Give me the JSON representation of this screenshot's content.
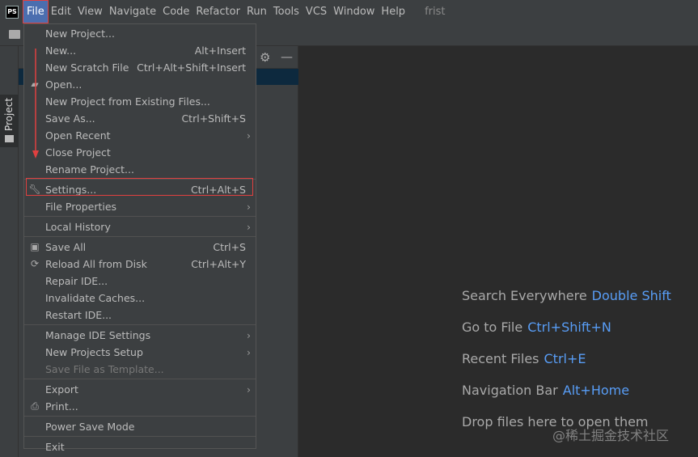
{
  "menubar": {
    "logo": "PS",
    "items": [
      "File",
      "Edit",
      "View",
      "Navigate",
      "Code",
      "Refactor",
      "Run",
      "Tools",
      "VCS",
      "Window",
      "Help"
    ],
    "project_name": "frist"
  },
  "sidebar": {
    "tab_label": "Project"
  },
  "file_menu": [
    {
      "label": "New Project...",
      "shortcut": ""
    },
    {
      "label": "New...",
      "shortcut": "Alt+Insert"
    },
    {
      "label": "New Scratch File",
      "shortcut": "Ctrl+Alt+Shift+Insert"
    },
    {
      "label": "Open...",
      "shortcut": "",
      "icon": "folder-open-icon"
    },
    {
      "label": "New Project from Existing Files...",
      "shortcut": ""
    },
    {
      "label": "Save As...",
      "shortcut": "Ctrl+Shift+S"
    },
    {
      "label": "Open Recent",
      "shortcut": "",
      "submenu": true
    },
    {
      "label": "Close Project",
      "shortcut": ""
    },
    {
      "label": "Rename Project...",
      "shortcut": ""
    },
    {
      "separator": true
    },
    {
      "label": "Settings...",
      "shortcut": "Ctrl+Alt+S",
      "icon": "wrench-icon",
      "highlighted": true
    },
    {
      "label": "File Properties",
      "shortcut": "",
      "submenu": true
    },
    {
      "separator": true
    },
    {
      "label": "Local History",
      "shortcut": "",
      "submenu": true
    },
    {
      "separator": true
    },
    {
      "label": "Save All",
      "shortcut": "Ctrl+S",
      "icon": "save-icon"
    },
    {
      "label": "Reload All from Disk",
      "shortcut": "Ctrl+Alt+Y",
      "icon": "reload-icon"
    },
    {
      "label": "Repair IDE...",
      "shortcut": ""
    },
    {
      "label": "Invalidate Caches...",
      "shortcut": ""
    },
    {
      "label": "Restart IDE...",
      "shortcut": ""
    },
    {
      "separator": true
    },
    {
      "label": "Manage IDE Settings",
      "shortcut": "",
      "submenu": true
    },
    {
      "label": "New Projects Setup",
      "shortcut": "",
      "submenu": true
    },
    {
      "label": "Save File as Template...",
      "shortcut": "",
      "disabled": true
    },
    {
      "separator": true
    },
    {
      "label": "Export",
      "shortcut": "",
      "submenu": true
    },
    {
      "label": "Print...",
      "shortcut": "",
      "icon": "print-icon"
    },
    {
      "separator": true
    },
    {
      "label": "Power Save Mode",
      "shortcut": ""
    },
    {
      "separator": true
    },
    {
      "label": "Exit",
      "shortcut": ""
    }
  ],
  "welcome": [
    {
      "label": "Search Everywhere",
      "key": "Double Shift"
    },
    {
      "label": "Go to File",
      "key": "Ctrl+Shift+N"
    },
    {
      "label": "Recent Files",
      "key": "Ctrl+E"
    },
    {
      "label": "Navigation Bar",
      "key": "Alt+Home"
    },
    {
      "label": "Drop files here to open them",
      "key": ""
    }
  ],
  "watermark": "@稀土掘金技术社区",
  "colors": {
    "accent": "#4b6eaf",
    "shortcut": "#589df6",
    "annotation": "#e04040"
  }
}
